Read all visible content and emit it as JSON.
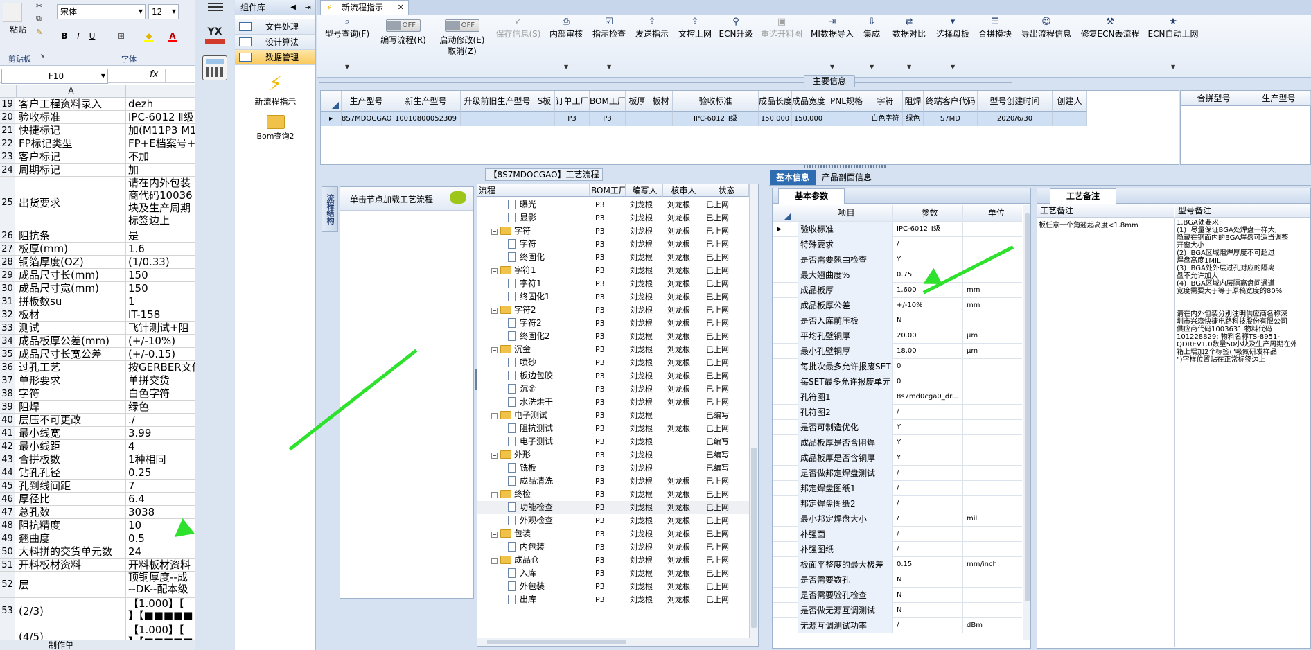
{
  "excel": {
    "ribbon": {
      "paste": "粘贴",
      "clipboard": "剪贴板",
      "font": "字体",
      "font_name": "宋体",
      "font_size": "12",
      "bold": "B",
      "italic": "I",
      "underline": "U"
    },
    "name_box": "F10",
    "fx": "fx",
    "col_a": "A",
    "rows": [
      {
        "n": "19",
        "a": "客户工程资料录入",
        "b": "dezh"
      },
      {
        "n": "20",
        "a": "验收标准",
        "b": "IPC-6012 Ⅱ级"
      },
      {
        "n": "21",
        "a": "快捷标记",
        "b": "加(M11P3 M1"
      },
      {
        "n": "22",
        "a": "FP标记类型",
        "b": "FP+E档案号+"
      },
      {
        "n": "23",
        "a": "客户标记",
        "b": "不加"
      },
      {
        "n": "24",
        "a": "周期标记",
        "b": "加"
      },
      {
        "n": "25",
        "a": "出货要求",
        "b": "请在内外包装\n商代码10036\n块及生产周期\n标签边上"
      },
      {
        "n": "26",
        "a": "阻抗条",
        "b": "是"
      },
      {
        "n": "27",
        "a": "板厚(mm)",
        "b": "1.6"
      },
      {
        "n": "28",
        "a": "铜箔厚度(OZ)",
        "b": "(1/0.33)"
      },
      {
        "n": "29",
        "a": "成品尺寸长(mm)",
        "b": "150"
      },
      {
        "n": "30",
        "a": "成品尺寸宽(mm)",
        "b": "150"
      },
      {
        "n": "31",
        "a": "拼板数su",
        "b": "1"
      },
      {
        "n": "32",
        "a": "板材",
        "b": "IT-158"
      },
      {
        "n": "33",
        "a": "测试",
        "b": "飞针测试+阻"
      },
      {
        "n": "34",
        "a": "成品板厚公差(mm)",
        "b": "(+/-10%)"
      },
      {
        "n": "35",
        "a": "成品尺寸长宽公差",
        "b": "(+/-0.15)"
      },
      {
        "n": "36",
        "a": "过孔工艺",
        "b": "按GERBER文件"
      },
      {
        "n": "37",
        "a": "单形要求",
        "b": "单拼交货"
      },
      {
        "n": "38",
        "a": "字符",
        "b": "白色字符"
      },
      {
        "n": "39",
        "a": "阻焊",
        "b": "绿色"
      },
      {
        "n": "40",
        "a": "层压不可更改",
        "b": "./"
      },
      {
        "n": "41",
        "a": "最小线宽",
        "b": "3.99"
      },
      {
        "n": "42",
        "a": "最小线距",
        "b": "4"
      },
      {
        "n": "43",
        "a": "合拼板数",
        "b": "1种相同"
      },
      {
        "n": "44",
        "a": "钻孔孔径",
        "b": "0.25"
      },
      {
        "n": "45",
        "a": "孔到线间距",
        "b": "7"
      },
      {
        "n": "46",
        "a": "厚径比",
        "b": "6.4"
      },
      {
        "n": "47",
        "a": "总孔数",
        "b": "3038"
      },
      {
        "n": "48",
        "a": "阻抗精度",
        "b": "10"
      },
      {
        "n": "49",
        "a": "翘曲度",
        "b": "0.5"
      },
      {
        "n": "50",
        "a": "大料拼的交货单元数",
        "b": "24"
      },
      {
        "n": "51",
        "a": "开料板材资料",
        "b": "开料板材资料"
      },
      {
        "n": "52",
        "a": "层",
        "b": "顶铜厚度--成\n--DK--配本级"
      },
      {
        "n": "53",
        "a": "(2/3)",
        "b": "【1.000】【\n】【■■■■■"
      },
      {
        "n": "",
        "a": "(4/5)",
        "b": "【1.000】【\n】【■■■■■"
      }
    ],
    "sheet_tab": "制作单"
  },
  "app": {
    "nav_header": "组件库",
    "nav_items": [
      "文件处理",
      "设计算法",
      "数据管理"
    ],
    "nav_icons": [
      {
        "label": "新流程指示"
      },
      {
        "label": "Bom查询2"
      }
    ],
    "vstrip_label": "YX",
    "doc_tab": "新流程指示",
    "toolbar": [
      {
        "label": "型号查询(F)",
        "icon": "magnifier-icon",
        "dd": true
      },
      {
        "label": "编写流程(R)",
        "toggle": "OFF"
      },
      {
        "label": "启动修改(E)",
        "label2": "取消(Z)",
        "toggle": "OFF"
      },
      {
        "label": "保存信息(S)",
        "icon": "check-icon",
        "disabled": true
      },
      {
        "label": "内部审核",
        "icon": "printer-icon",
        "dd": true
      },
      {
        "label": "指示检查",
        "icon": "checklist-icon",
        "dd": true
      },
      {
        "label": "发送指示",
        "icon": "upload-icon"
      },
      {
        "label": "文控上网",
        "icon": "upload-icon"
      },
      {
        "label": "ECN升级",
        "icon": "binoculars-icon"
      },
      {
        "label": "重选开料图",
        "icon": "image-icon",
        "disabled": true
      },
      {
        "label": "MI数据导入",
        "icon": "import-icon",
        "dd": true
      },
      {
        "label": "集成",
        "icon": "download-icon",
        "dd": true
      },
      {
        "label": "数据对比",
        "icon": "compare-icon",
        "dd": true
      },
      {
        "label": "选择母板",
        "icon": "select-icon",
        "dd": true
      },
      {
        "label": "合拼模块",
        "icon": "list-icon"
      },
      {
        "label": "导出流程信息",
        "icon": "smile-icon"
      },
      {
        "label": "修复ECN丢流程",
        "icon": "wrench-icon"
      },
      {
        "label": "ECN自动上网",
        "icon": "star-icon",
        "dd": true
      }
    ],
    "main_info_title": "主要信息",
    "main_cols": [
      "生产型号",
      "新生产型号",
      "升级前旧生产型号",
      "S板",
      "订单工厂",
      "BOM工厂",
      "板厚",
      "板材",
      "验收标准",
      "成品长度",
      "成品宽度",
      "PNL规格",
      "字符",
      "阻焊",
      "终端客户代码",
      "型号创建时间",
      "创建人"
    ],
    "main_row": [
      "8S7MDOCGAO",
      "10010800052309",
      "",
      "",
      "P3",
      "P3",
      "",
      "",
      "IPC-6012 Ⅱ级",
      "150.000",
      "150.000",
      "",
      "白色字符",
      "绿色",
      "S7MD",
      "2020/6/30",
      ""
    ],
    "right_cols": [
      "合拼型号",
      "生产型号"
    ],
    "flow_title": "【8S7MDOCGAO】工艺流程",
    "flow_vtab": "流程结构",
    "load_hint": "单击节点加载工艺流程",
    "tree_cols": [
      "流程",
      "BOM工厂",
      "编写人",
      "核审人",
      "状态"
    ],
    "tree": [
      {
        "lvl": 2,
        "t": "doc",
        "name": "曝光",
        "f": "P3",
        "w": "刘龙根",
        "r": "刘龙根",
        "s": "已上网"
      },
      {
        "lvl": 2,
        "t": "doc",
        "name": "显影",
        "f": "P3",
        "w": "刘龙根",
        "r": "刘龙根",
        "s": "已上网"
      },
      {
        "lvl": 1,
        "t": "fold",
        "name": "字符",
        "f": "P3",
        "w": "刘龙根",
        "r": "刘龙根",
        "s": "已上网"
      },
      {
        "lvl": 2,
        "t": "doc",
        "name": "字符",
        "f": "P3",
        "w": "刘龙根",
        "r": "刘龙根",
        "s": "已上网"
      },
      {
        "lvl": 2,
        "t": "doc",
        "name": "终固化",
        "f": "P3",
        "w": "刘龙根",
        "r": "刘龙根",
        "s": "已上网"
      },
      {
        "lvl": 1,
        "t": "fold",
        "name": "字符1",
        "f": "P3",
        "w": "刘龙根",
        "r": "刘龙根",
        "s": "已上网"
      },
      {
        "lvl": 2,
        "t": "doc",
        "name": "字符1",
        "f": "P3",
        "w": "刘龙根",
        "r": "刘龙根",
        "s": "已上网"
      },
      {
        "lvl": 2,
        "t": "doc",
        "name": "终固化1",
        "f": "P3",
        "w": "刘龙根",
        "r": "刘龙根",
        "s": "已上网"
      },
      {
        "lvl": 1,
        "t": "fold",
        "name": "字符2",
        "f": "P3",
        "w": "刘龙根",
        "r": "刘龙根",
        "s": "已上网"
      },
      {
        "lvl": 2,
        "t": "doc",
        "name": "字符2",
        "f": "P3",
        "w": "刘龙根",
        "r": "刘龙根",
        "s": "已上网"
      },
      {
        "lvl": 2,
        "t": "doc",
        "name": "终固化2",
        "f": "P3",
        "w": "刘龙根",
        "r": "刘龙根",
        "s": "已上网"
      },
      {
        "lvl": 1,
        "t": "fold",
        "name": "沉金",
        "f": "P3",
        "w": "刘龙根",
        "r": "刘龙根",
        "s": "已上网"
      },
      {
        "lvl": 2,
        "t": "doc",
        "name": "喷砂",
        "f": "P3",
        "w": "刘龙根",
        "r": "刘龙根",
        "s": "已上网"
      },
      {
        "lvl": 2,
        "t": "doc",
        "name": "板边包胶",
        "f": "P3",
        "w": "刘龙根",
        "r": "刘龙根",
        "s": "已上网"
      },
      {
        "lvl": 2,
        "t": "doc",
        "name": "沉金",
        "f": "P3",
        "w": "刘龙根",
        "r": "刘龙根",
        "s": "已上网"
      },
      {
        "lvl": 2,
        "t": "doc",
        "name": "水洗烘干",
        "f": "P3",
        "w": "刘龙根",
        "r": "刘龙根",
        "s": "已上网"
      },
      {
        "lvl": 1,
        "t": "fold",
        "name": "电子测试",
        "f": "P3",
        "w": "刘龙根",
        "r": "",
        "s": "已编写"
      },
      {
        "lvl": 2,
        "t": "doc",
        "name": "阻抗测试",
        "f": "P3",
        "w": "刘龙根",
        "r": "刘龙根",
        "s": "已上网"
      },
      {
        "lvl": 2,
        "t": "doc",
        "name": "电子测试",
        "f": "P3",
        "w": "刘龙根",
        "r": "",
        "s": "已编写"
      },
      {
        "lvl": 1,
        "t": "fold",
        "name": "外形",
        "f": "P3",
        "w": "刘龙根",
        "r": "",
        "s": "已编写"
      },
      {
        "lvl": 2,
        "t": "doc",
        "name": "铣板",
        "f": "P3",
        "w": "刘龙根",
        "r": "",
        "s": "已编写"
      },
      {
        "lvl": 2,
        "t": "doc",
        "name": "成品清洗",
        "f": "P3",
        "w": "刘龙根",
        "r": "刘龙根",
        "s": "已上网"
      },
      {
        "lvl": 1,
        "t": "fold",
        "name": "终检",
        "f": "P3",
        "w": "刘龙根",
        "r": "刘龙根",
        "s": "已上网"
      },
      {
        "lvl": 2,
        "t": "doc",
        "name": "功能检查",
        "f": "P3",
        "w": "刘龙根",
        "r": "刘龙根",
        "s": "已上网"
      },
      {
        "lvl": 2,
        "t": "doc",
        "name": "外观检查",
        "f": "P3",
        "w": "刘龙根",
        "r": "刘龙根",
        "s": "已上网"
      },
      {
        "lvl": 1,
        "t": "fold",
        "name": "包装",
        "f": "P3",
        "w": "刘龙根",
        "r": "刘龙根",
        "s": "已上网"
      },
      {
        "lvl": 2,
        "t": "doc",
        "name": "内包装",
        "f": "P3",
        "w": "刘龙根",
        "r": "刘龙根",
        "s": "已上网"
      },
      {
        "lvl": 1,
        "t": "fold",
        "name": "成品仓",
        "f": "P3",
        "w": "刘龙根",
        "r": "刘龙根",
        "s": "已上网"
      },
      {
        "lvl": 2,
        "t": "doc",
        "name": "入库",
        "f": "P3",
        "w": "刘龙根",
        "r": "刘龙根",
        "s": "已上网"
      },
      {
        "lvl": 2,
        "t": "doc",
        "name": "外包装",
        "f": "P3",
        "w": "刘龙根",
        "r": "刘龙根",
        "s": "已上网"
      },
      {
        "lvl": 2,
        "t": "doc",
        "name": "出库",
        "f": "P3",
        "w": "刘龙根",
        "r": "刘龙根",
        "s": "已上网"
      }
    ],
    "tabs_right": [
      "基本信息",
      "产品剖面信息"
    ],
    "basic_params_tab": "基本参数",
    "param_cols": [
      "项目",
      "参数",
      "单位"
    ],
    "params": [
      [
        "验收标准",
        "IPC-6012 Ⅱ级",
        ""
      ],
      [
        "特殊要求",
        "/",
        ""
      ],
      [
        "是否需要翘曲检查",
        "Y",
        ""
      ],
      [
        "最大翘曲度%",
        "0.75",
        ""
      ],
      [
        "成品板厚",
        "1.600",
        "mm"
      ],
      [
        "成品板厚公差",
        "+/-10%",
        "mm"
      ],
      [
        "是否入库前压板",
        "N",
        ""
      ],
      [
        "平均孔壁铜厚",
        "20.00",
        "μm"
      ],
      [
        "最小孔壁铜厚",
        "18.00",
        "μm"
      ],
      [
        "每批次最多允许报废SET",
        "0",
        ""
      ],
      [
        "每SET最多允许报废单元",
        "0",
        ""
      ],
      [
        "孔符图1",
        "8s7md0cga0_dr...",
        ""
      ],
      [
        "孔符图2",
        "/",
        ""
      ],
      [
        "是否可制造优化",
        "Y",
        ""
      ],
      [
        "成品板厚是否含阻焊",
        "Y",
        ""
      ],
      [
        "成品板厚是否含铜厚",
        "Y",
        ""
      ],
      [
        "是否做邦定焊盘测试",
        "/",
        ""
      ],
      [
        "邦定焊盘图纸1",
        "/",
        ""
      ],
      [
        "邦定焊盘图纸2",
        "/",
        ""
      ],
      [
        "最小邦定焊盘大小",
        "/",
        "mil"
      ],
      [
        "补强面",
        "/",
        ""
      ],
      [
        "补强图纸",
        "/",
        ""
      ],
      [
        "板面平整度的最大极差",
        "0.15",
        "mm/inch"
      ],
      [
        "是否需要数孔",
        "N",
        ""
      ],
      [
        "是否需要验孔检查",
        "N",
        ""
      ],
      [
        "是否做无源互调测试",
        "N",
        ""
      ],
      [
        "无源互调测试功率",
        "/",
        "dBm"
      ]
    ],
    "craft_tab": "工艺备注",
    "craft_cols": [
      "工艺备注",
      "型号备注"
    ],
    "craft_note": "板任意一个角翘起高度<1.8mm",
    "model_note": "1.BGA处要求:\n(1)  尽量保证BGA处焊盘一样大,\n隐藏在铜面内的BGA焊盘可适当调整\n开窗大小\n(2)  BGA区域阻焊厚度不可超过\n焊盘高度1MIL\n(3)  BGA处外层过孔对应的隔离\n盘不允许加大\n(4)  BGA区域内层隔离盘间通道\n宽度需要大于等于原稿宽度的80%\n\n\n请在内外包装分别注明供应商名称深\n圳市兴森快捷电路科技股份有限公司\n供应商代码1003631 物料代码\n101228829; 物料名称TS-8951-\nQDREV1.0数量50小块及生产周期在外\n箱上增加2个标签(\"吸氮研发样品\n\")字样位置贴在正常标签边上"
  }
}
